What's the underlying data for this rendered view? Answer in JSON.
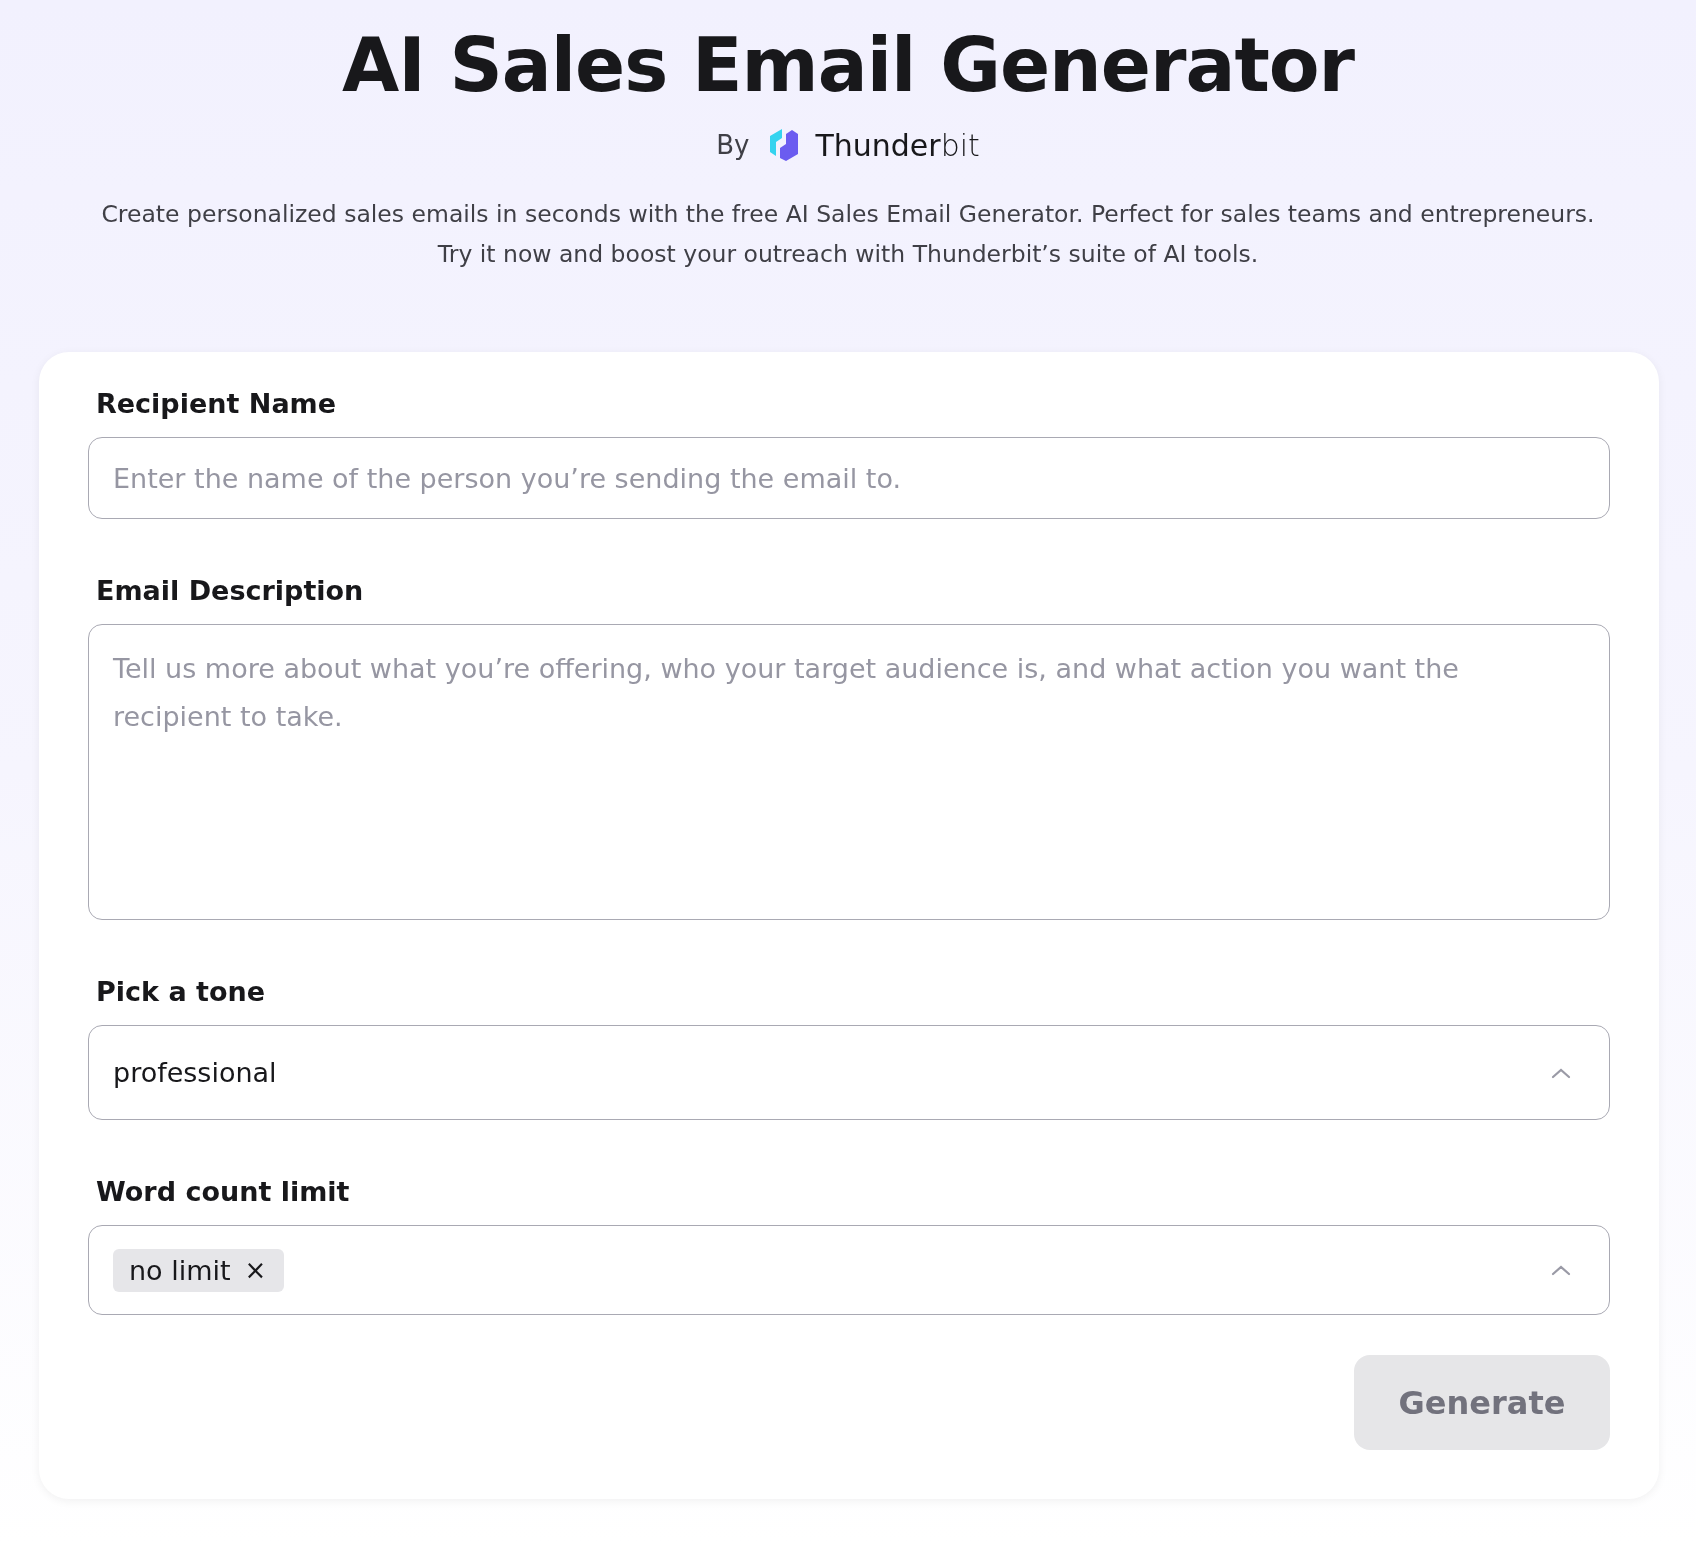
{
  "header": {
    "title": "AI Sales Email Generator",
    "by": "By",
    "brand": "**Thunder**bit",
    "description": "Create personalized sales emails in seconds with the free AI Sales Email Generator. Perfect for sales teams and entrepreneurs. Try it now and boost your outreach with Thunderbit’s suite of AI tools."
  },
  "form": {
    "fields": [
      {
        "kind": "input",
        "label": "Recipient Name",
        "placeholder": "Enter the name of the person you’re sending the email to."
      },
      {
        "kind": "textarea",
        "label": "Email Description",
        "placeholder": "Tell us more about what you’re offering, who your target audience is, and what action you want the recipient to take."
      },
      {
        "kind": "select",
        "label": "Pick a tone",
        "value": "professional"
      },
      {
        "kind": "multiselect",
        "label": "Word count limit",
        "tags": [
          {
            "label": "no limit",
            "remove": "×"
          }
        ]
      }
    ],
    "button": {
      "label": "Generate",
      "disabled": true
    }
  }
}
